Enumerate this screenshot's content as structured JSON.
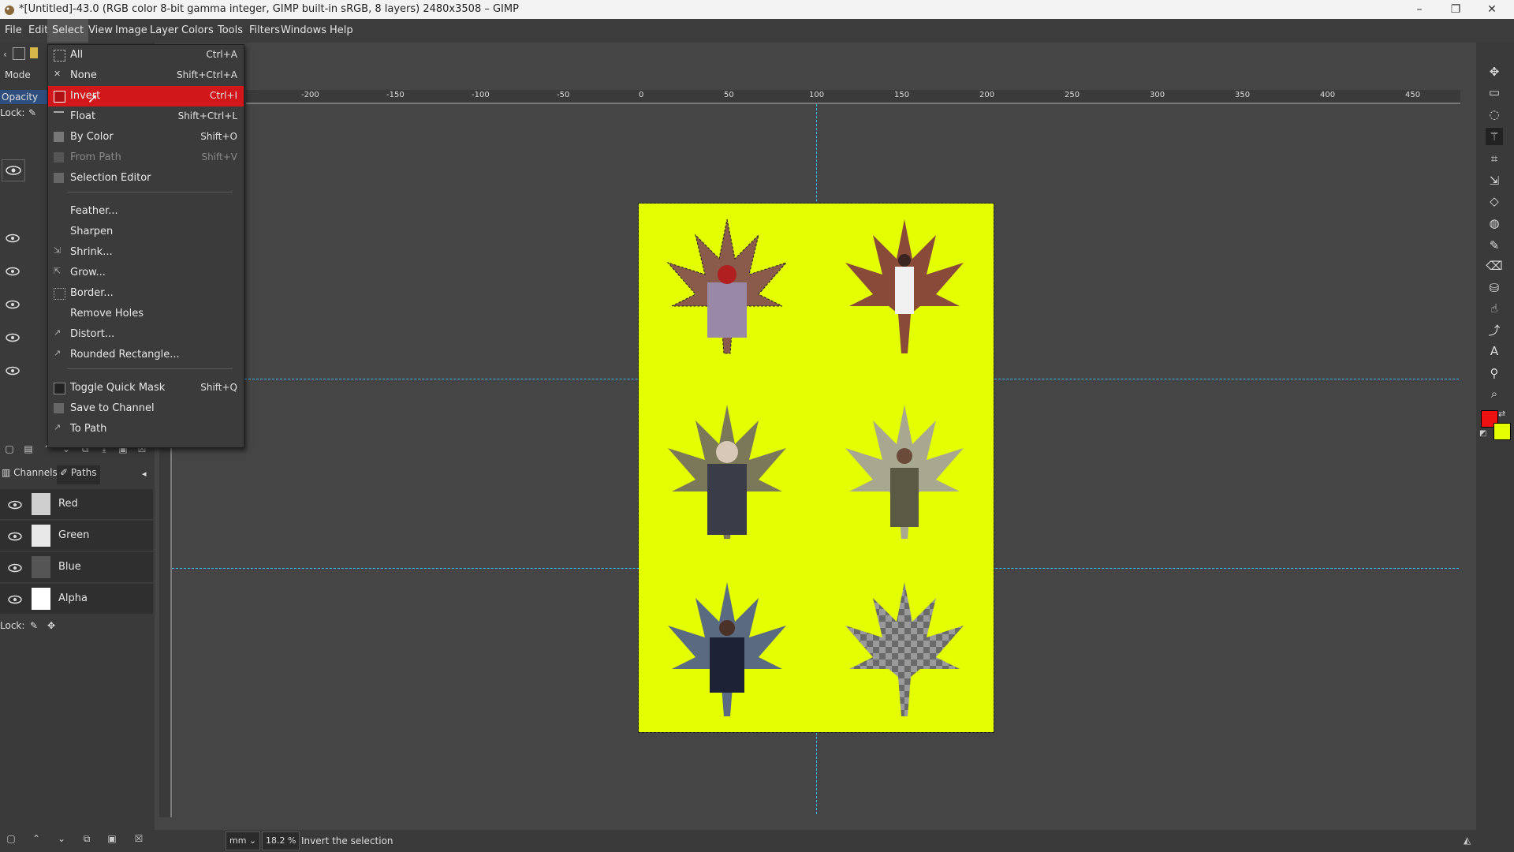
{
  "window": {
    "title": "*[Untitled]-43.0 (RGB color 8-bit gamma integer, GIMP built-in sRGB, 8 layers) 2480x3508 – GIMP",
    "minimize": "–",
    "maximize": "❐",
    "close": "✕"
  },
  "menubar": [
    "File",
    "Edit",
    "Select",
    "View",
    "Image",
    "Layer",
    "Colors",
    "Tools",
    "Filters",
    "Windows",
    "Help"
  ],
  "layers_panel": {
    "mode_label": "Mode",
    "opacity_label": "Opacity",
    "lock_label": "Lock:"
  },
  "select_menu": {
    "items": [
      {
        "label": "All",
        "shortcut": "Ctrl+A"
      },
      {
        "label": "None",
        "shortcut": "Shift+Ctrl+A"
      },
      {
        "label": "Invert",
        "shortcut": "Ctrl+I"
      },
      {
        "label": "Float",
        "shortcut": "Shift+Ctrl+L"
      },
      {
        "label": "By Color",
        "shortcut": "Shift+O"
      },
      {
        "label": "From Path",
        "shortcut": "Shift+V"
      },
      {
        "label": "Selection Editor",
        "shortcut": ""
      },
      {
        "label": "Feather...",
        "shortcut": ""
      },
      {
        "label": "Sharpen",
        "shortcut": ""
      },
      {
        "label": "Shrink...",
        "shortcut": ""
      },
      {
        "label": "Grow...",
        "shortcut": ""
      },
      {
        "label": "Border...",
        "shortcut": ""
      },
      {
        "label": "Remove Holes",
        "shortcut": ""
      },
      {
        "label": "Distort...",
        "shortcut": ""
      },
      {
        "label": "Rounded Rectangle...",
        "shortcut": ""
      },
      {
        "label": "Toggle Quick Mask",
        "shortcut": "Shift+Q"
      },
      {
        "label": "Save to Channel",
        "shortcut": ""
      },
      {
        "label": "To Path",
        "shortcut": ""
      }
    ],
    "highlighted": "Invert",
    "disabled": [
      "From Path"
    ]
  },
  "ruler": {
    "top_ticks": [
      "-200",
      "-150",
      "-100",
      "-50",
      "0",
      "50",
      "100",
      "150",
      "200",
      "250",
      "300",
      "350",
      "400",
      "450"
    ]
  },
  "channels_panel": {
    "tabs": [
      "Channels",
      "Paths"
    ],
    "channels": [
      "Red",
      "Green",
      "Blue",
      "Alpha"
    ],
    "lock_label": "Lock:"
  },
  "statusbar": {
    "unit": "mm",
    "zoom": "18.2 %",
    "message": "Invert the selection"
  },
  "colors": {
    "foreground": "#ee1111",
    "background": "#e4ff00",
    "highlight": "#d2171b",
    "image_bg": "#e4ff00"
  }
}
